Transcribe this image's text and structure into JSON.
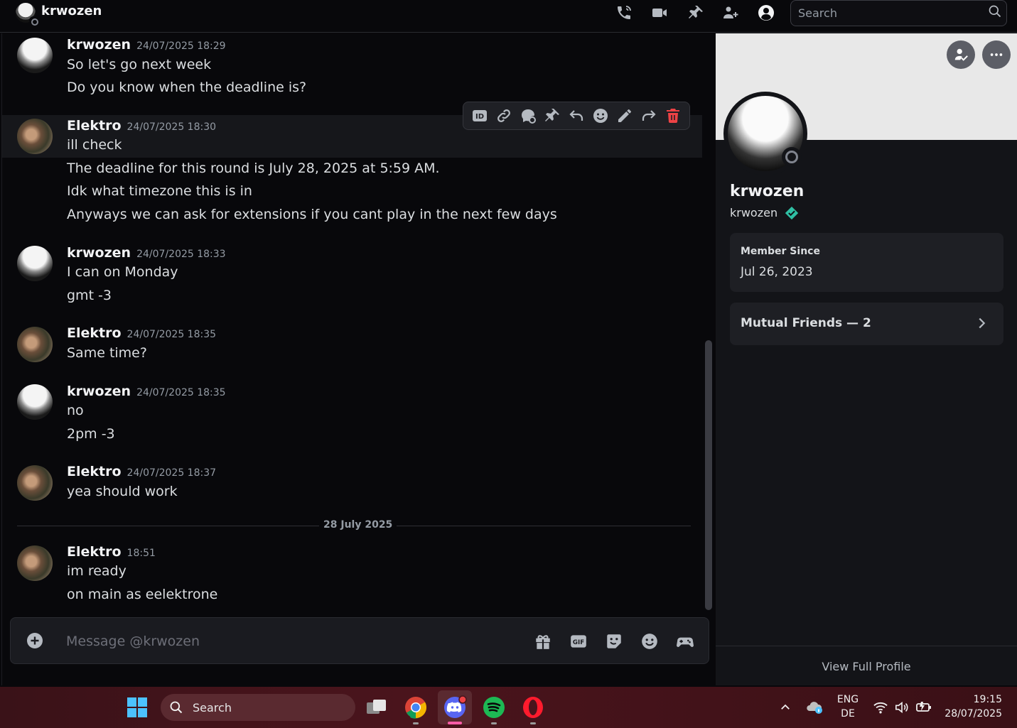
{
  "header": {
    "title": "krwozen",
    "search_placeholder": "Search"
  },
  "messages": [
    {
      "author": "krwozen",
      "time": "24/07/2025 18:29",
      "lines": [
        "So let's go next week",
        "Do you know when the deadline is?"
      ]
    },
    {
      "author": "Elektro",
      "time": "24/07/2025 18:30",
      "lines": [
        "ill check",
        "The deadline for this round is July 28, 2025 at 5:59 AM.",
        "Idk what timezone this is in",
        "Anyways we can ask for extensions if you cant play in the next few days"
      ]
    },
    {
      "author": "krwozen",
      "time": "24/07/2025 18:33",
      "lines": [
        "I can on Monday",
        "gmt -3"
      ]
    },
    {
      "author": "Elektro",
      "time": "24/07/2025 18:35",
      "lines": [
        "Same time?"
      ]
    },
    {
      "author": "krwozen",
      "time": "24/07/2025 18:35",
      "lines": [
        "no",
        "2pm -3"
      ]
    },
    {
      "author": "Elektro",
      "time": "24/07/2025 18:37",
      "lines": [
        "yea should work"
      ]
    },
    {
      "author": "Elektro",
      "time": "18:51",
      "lines": [
        "im ready",
        "on main as eelektrone"
      ]
    }
  ],
  "date_divider": "28 July 2025",
  "composer": {
    "placeholder": "Message @krwozen"
  },
  "profile": {
    "display_name": "krwozen",
    "username": "krwozen",
    "member_since_label": "Member Since",
    "member_since": "Jul 26, 2023",
    "mutual_friends": "Mutual Friends — 2",
    "view_full_profile": "View Full Profile"
  },
  "taskbar": {
    "search_label": "Search",
    "lang_top": "ENG",
    "lang_bottom": "DE",
    "time": "19:15",
    "date": "28/07/2025"
  },
  "colors": {
    "danger": "#ed4245",
    "verified": "#2fc0a4",
    "accent": "#5865f2"
  }
}
